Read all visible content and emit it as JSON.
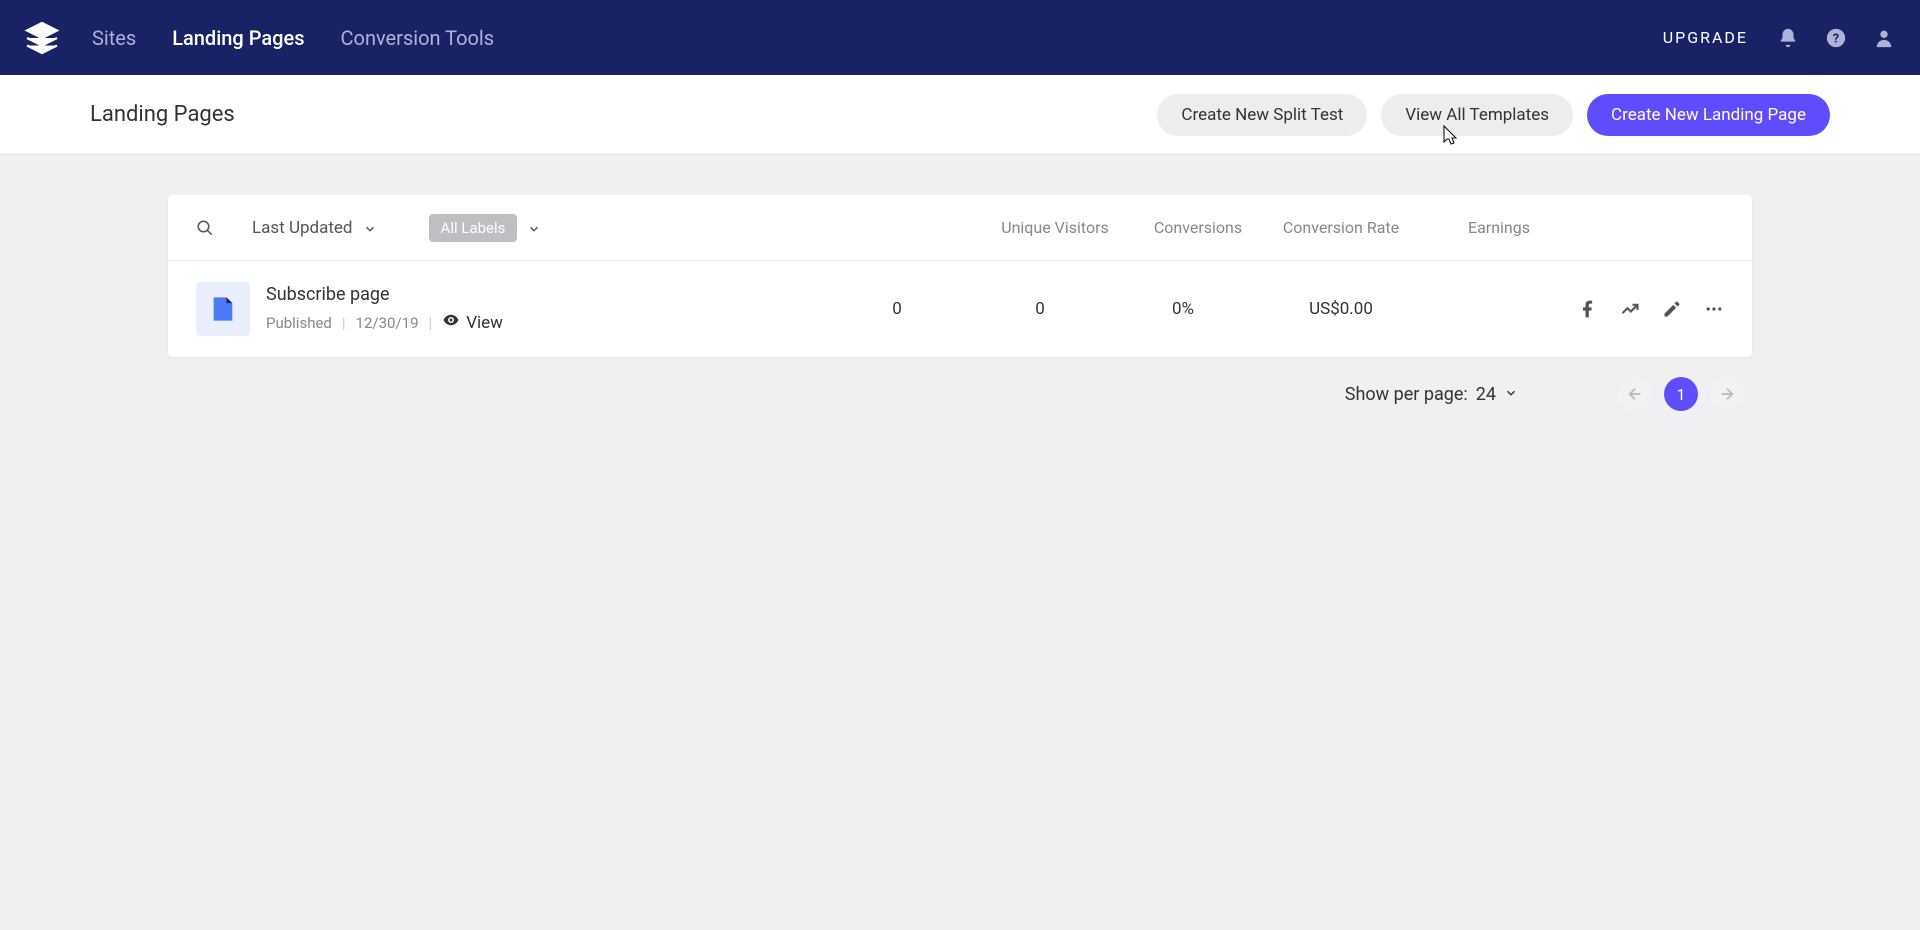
{
  "nav": {
    "tabs": [
      "Sites",
      "Landing Pages",
      "Conversion Tools"
    ],
    "active_tab_index": 1,
    "upgrade": "UPGRADE"
  },
  "subheader": {
    "title": "Landing Pages",
    "btn_split_test": "Create New Split Test",
    "btn_templates": "View All Templates",
    "btn_new_page": "Create New Landing Page"
  },
  "table": {
    "sort_label": "Last Updated",
    "filter_label": "All Labels",
    "columns": {
      "visitors": "Unique Visitors",
      "conversions": "Conversions",
      "rate": "Conversion Rate",
      "earnings": "Earnings"
    },
    "row": {
      "title": "Subscribe page",
      "status": "Published",
      "date": "12/30/19",
      "view": "View",
      "visitors": "0",
      "conversions": "0",
      "rate": "0%",
      "earnings": "US$0.00"
    }
  },
  "pagination": {
    "per_page_label": "Show per page:",
    "per_page_value": "24",
    "current_page": "1"
  }
}
